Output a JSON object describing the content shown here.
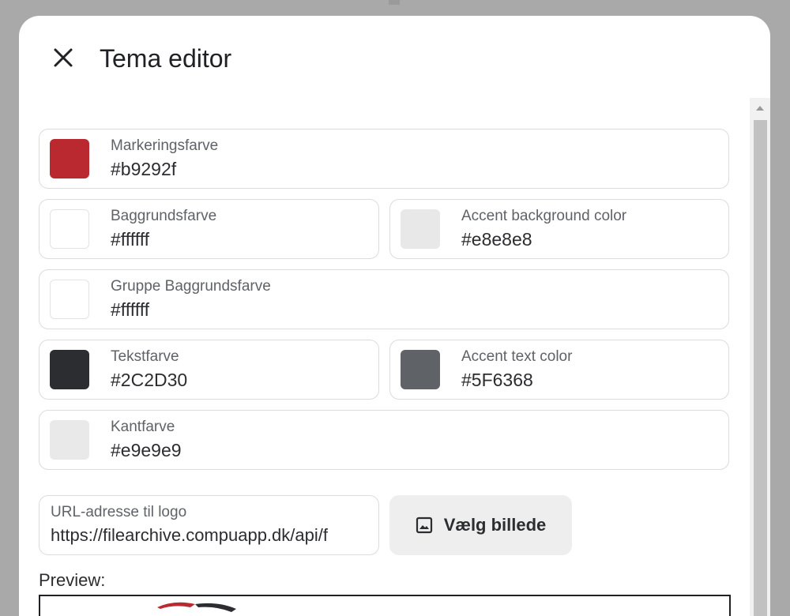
{
  "dialog": {
    "title": "Tema editor",
    "close_icon": "close-icon"
  },
  "fields": {
    "markering": {
      "label": "Markeringsfarve",
      "value": "#b9292f",
      "color": "#b9292f"
    },
    "baggrund": {
      "label": "Baggrundsfarve",
      "value": "#ffffff",
      "color": "#ffffff"
    },
    "accent_bg": {
      "label": "Accent background color",
      "value": "#e8e8e8",
      "color": "#e8e8e8"
    },
    "gruppe_baggrund": {
      "label": "Gruppe Baggrundsfarve",
      "value": "#ffffff",
      "color": "#ffffff"
    },
    "tekst": {
      "label": "Tekstfarve",
      "value": "#2C2D30",
      "color": "#2C2D30"
    },
    "accent_text": {
      "label": "Accent text color",
      "value": "#5F6368",
      "color": "#5F6368"
    },
    "kant": {
      "label": "Kantfarve",
      "value": "#e9e9e9",
      "color": "#e9e9e9"
    }
  },
  "logo": {
    "label": "URL-adresse til logo",
    "value": "https://filearchive.compuapp.dk/api/f",
    "button_label": "Vælg billede",
    "button_icon": "image-icon"
  },
  "preview": {
    "label": "Preview:"
  }
}
